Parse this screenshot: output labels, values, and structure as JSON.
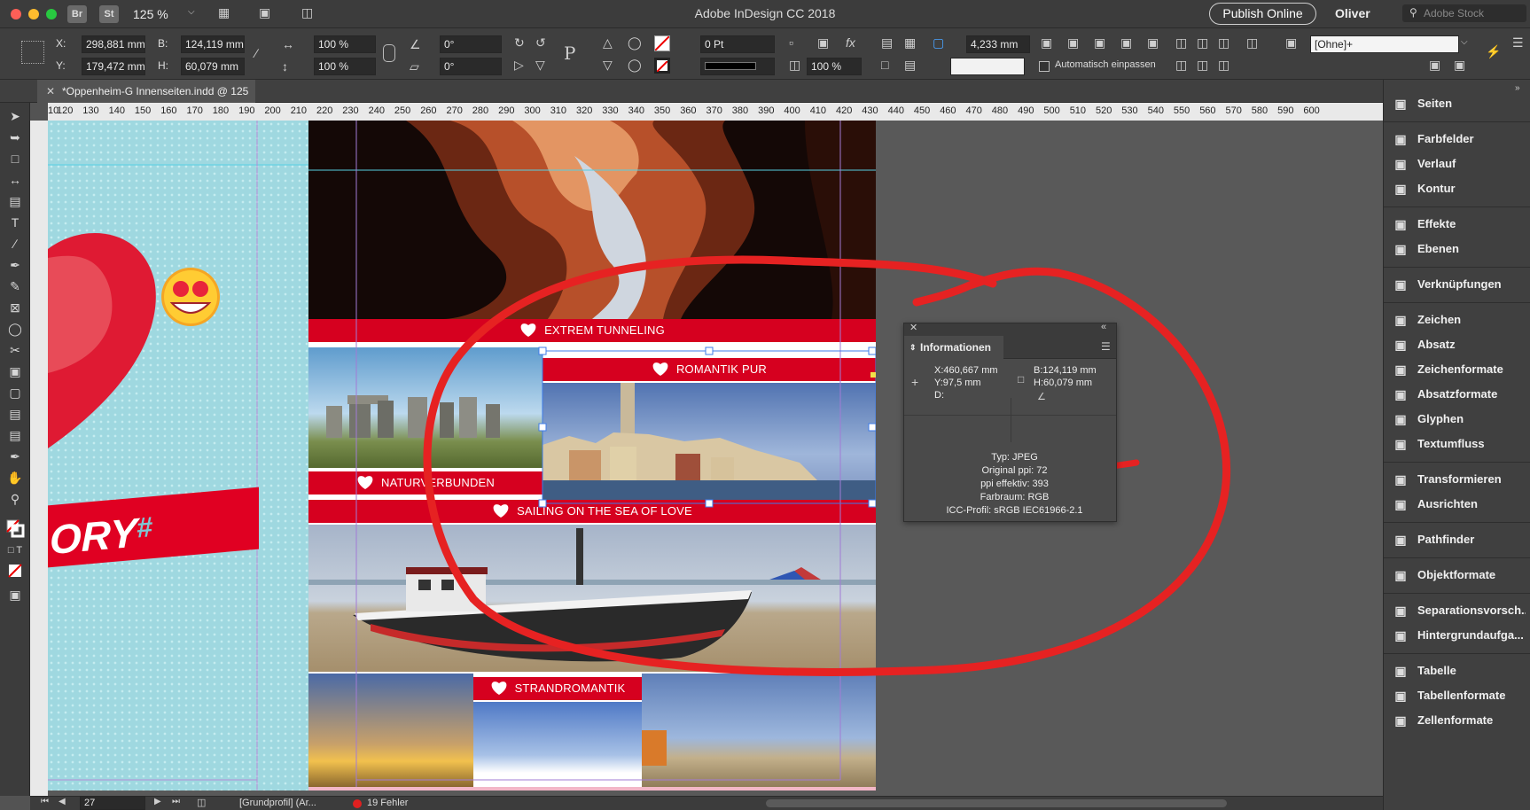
{
  "app": {
    "window_title": "Adobe InDesign CC 2018",
    "bridge": "Br",
    "stock": "St",
    "zoom": "125 %",
    "publish": "Publish Online",
    "user": "Oliver",
    "stock_search": "Adobe Stock"
  },
  "controlbar": {
    "x_label": "X:",
    "x": "298,881 mm",
    "y_label": "Y:",
    "y": "179,472 mm",
    "w_label": "B:",
    "w": "124,119 mm",
    "h_label": "H:",
    "h": "60,079 mm",
    "scale_x": "100 %",
    "scale_y": "100 %",
    "rotate": "0°",
    "shear": "0°",
    "stroke_weight": "0 Pt",
    "opacity": "100 %",
    "fx": "fx",
    "column_gap": "4,233 mm",
    "autofit": "Automatisch einpassen",
    "object_style": "[Ohne]+"
  },
  "document": {
    "tab_title": "*Oppenheim-G Innenseiten.indd @ 125 %"
  },
  "ruler": {
    "h_labels": [
      "10",
      "120",
      "130",
      "140",
      "150",
      "160",
      "170",
      "180",
      "190",
      "200",
      "210",
      "220",
      "230",
      "240",
      "250",
      "260",
      "270",
      "280",
      "290",
      "300",
      "310",
      "320",
      "330",
      "340",
      "350",
      "360",
      "370",
      "380",
      "390",
      "400",
      "410",
      "420",
      "430",
      "440",
      "450",
      "460",
      "470",
      "480",
      "490",
      "500",
      "510",
      "520",
      "530",
      "540",
      "550",
      "560",
      "570",
      "580",
      "590",
      "600"
    ]
  },
  "page": {
    "left_text": "ORY",
    "left_hash": "#",
    "banners": {
      "extrem": "EXTREM TUNNELING",
      "romantik": "ROMANTIK PUR",
      "natur": "NATURVERBUNDEN",
      "sailing": "SAILING ON THE SEA OF LOVE",
      "strand": "STRANDROMANTIK"
    }
  },
  "info_panel": {
    "title": "Informationen",
    "x": "X:460,667 mm",
    "y": "Y:97,5 mm",
    "d": "D:",
    "w": "B:124,119 mm",
    "h": "H:60,079 mm",
    "typ": "Typ: JPEG",
    "orig_ppi": "Original ppi: 72",
    "eff_ppi": "ppi effektiv: 393",
    "farbraum": "Farbraum: RGB",
    "icc": "ICC-Profil: sRGB IEC61966-2.1"
  },
  "panels": [
    {
      "label": "Seiten",
      "icon": "pages-icon"
    },
    {
      "label": "Farbfelder",
      "icon": "swatches-icon"
    },
    {
      "label": "Verlauf",
      "icon": "gradient-icon"
    },
    {
      "label": "Kontur",
      "icon": "stroke-icon"
    },
    {
      "label": "Effekte",
      "icon": "effects-icon"
    },
    {
      "label": "Ebenen",
      "icon": "layers-icon"
    },
    {
      "label": "Verknüpfungen",
      "icon": "links-icon"
    },
    {
      "label": "Zeichen",
      "icon": "character-icon"
    },
    {
      "label": "Absatz",
      "icon": "paragraph-icon"
    },
    {
      "label": "Zeichenformate",
      "icon": "character-styles-icon"
    },
    {
      "label": "Absatzformate",
      "icon": "paragraph-styles-icon"
    },
    {
      "label": "Glyphen",
      "icon": "glyphs-icon"
    },
    {
      "label": "Textumfluss",
      "icon": "text-wrap-icon"
    },
    {
      "label": "Transformieren",
      "icon": "transform-icon"
    },
    {
      "label": "Ausrichten",
      "icon": "align-icon"
    },
    {
      "label": "Pathfinder",
      "icon": "pathfinder-icon"
    },
    {
      "label": "Objektformate",
      "icon": "object-styles-icon"
    },
    {
      "label": "Separationsvorsch...",
      "icon": "separations-icon"
    },
    {
      "label": "Hintergrundaufga...",
      "icon": "background-tasks-icon"
    },
    {
      "label": "Tabelle",
      "icon": "table-icon"
    },
    {
      "label": "Tabellenformate",
      "icon": "table-styles-icon"
    },
    {
      "label": "Zellenformate",
      "icon": "cell-styles-icon"
    }
  ],
  "status": {
    "page": "27",
    "profile": "[Grundprofil] (Ar...",
    "errors": "19 Fehler"
  },
  "colors": {
    "accent_red": "#d6001f",
    "panel_bg": "#404040",
    "page_cyan": "#9fd8e0"
  }
}
